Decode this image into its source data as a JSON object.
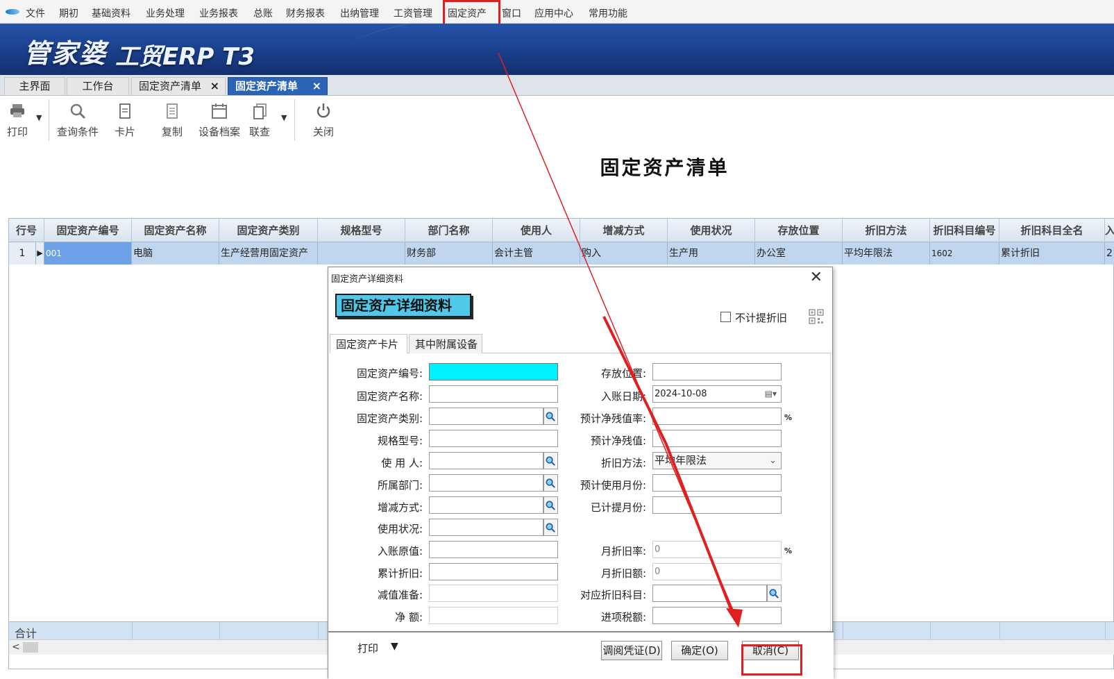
{
  "menubar": {
    "items": [
      "文件",
      "期初",
      "基础资料",
      "业务处理",
      "业务报表",
      "总账",
      "财务报表",
      "出纳管理",
      "工资管理",
      "固定资产",
      "窗口",
      "应用中心",
      "常用功能"
    ]
  },
  "banner": {
    "brand_cn": "管家婆",
    "brand_en": "工贸ERP T3"
  },
  "tabs": [
    {
      "label": "主界面"
    },
    {
      "label": "工作台"
    },
    {
      "label": "固定资产清单",
      "close": "×"
    },
    {
      "label": "固定资产清单",
      "close": "×"
    }
  ],
  "toolbar": {
    "items": [
      "打印",
      "查询条件",
      "卡片",
      "复制",
      "设备档案",
      "联查",
      "关闭"
    ]
  },
  "report": {
    "title": "固定资产清单"
  },
  "grid": {
    "headers": [
      "行号",
      "固定资产编号",
      "固定资产名称",
      "固定资产类别",
      "规格型号",
      "部门名称",
      "使用人",
      "增减方式",
      "使用状况",
      "存放位置",
      "折旧方法",
      "折旧科目编号",
      "折旧科目全名",
      "入"
    ],
    "row": [
      "1",
      "001",
      "电脑",
      "生产经营用固定资产",
      "",
      "财务部",
      "会计主管",
      "购入",
      "生产用",
      "办公室",
      "平均年限法",
      "1602",
      "累计折旧",
      "2"
    ],
    "sum_label": "合计"
  },
  "dialog": {
    "title": "固定资产详细资料",
    "badge": "固定资产详细资料",
    "no_depreciation_label": "不计提折旧",
    "tabs": [
      "固定资产卡片",
      "其中附属设备"
    ],
    "left_fields": {
      "asset_no": "固定资产编号:",
      "asset_name": "固定资产名称:",
      "asset_category": "固定资产类别:",
      "spec": "规格型号:",
      "user": "使  用  人:",
      "department": "所属部门:",
      "change_method": "增减方式:",
      "status": "使用状况:",
      "original_value": "入账原值:",
      "accum_depreciation": "累计折旧:",
      "impairment": "减值准备:",
      "net_amount": "净       额:"
    },
    "right_fields": {
      "location": "存放位置:",
      "entry_date": "入账日期:",
      "entry_date_value": "2024-10-08",
      "salvage_rate": "预计净残值率:",
      "salvage_value": "预计净残值:",
      "method": "折旧方法:",
      "method_value": "平均年限法",
      "expected_months": "预计使用月份:",
      "accrued_months": "已计提月份:",
      "monthly_rate": "月折旧率:",
      "monthly_rate_value": "0",
      "monthly_amount": "月折旧额:",
      "monthly_amount_value": "0",
      "account": "对应折旧科目:",
      "input_tax": "进项税额:",
      "percent": "%"
    },
    "footer": {
      "print": "打印",
      "voucher": "调阅凭证(D)",
      "ok": "确定(O)",
      "cancel": "取消(C)"
    }
  }
}
